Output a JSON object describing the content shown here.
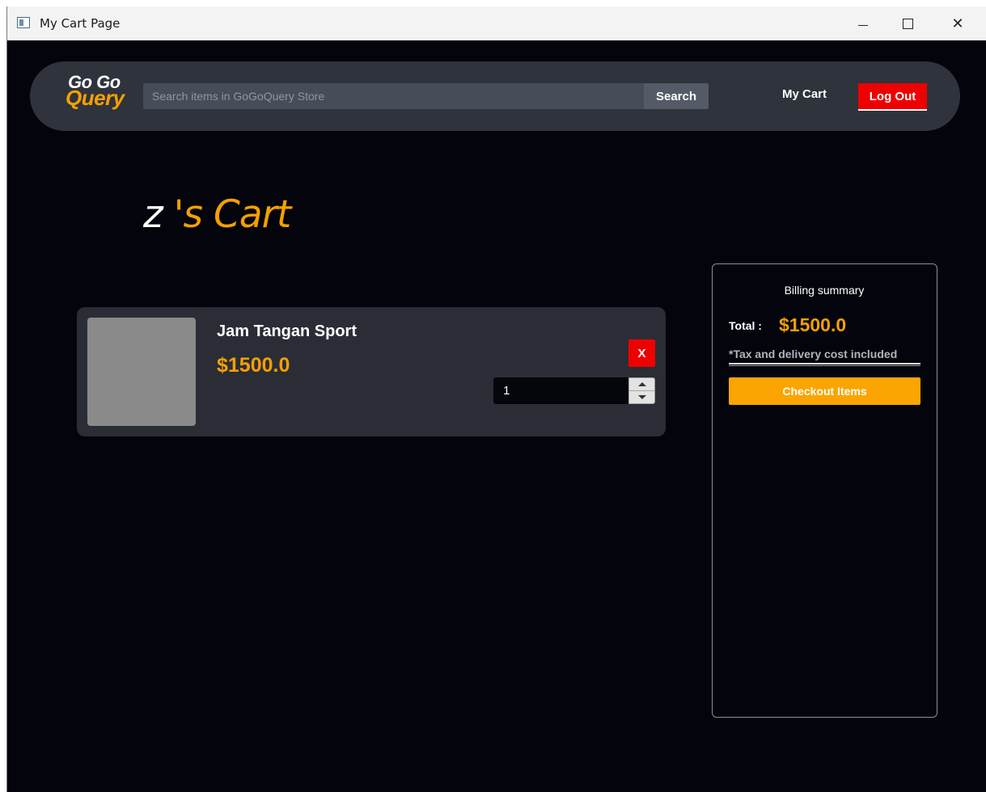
{
  "window": {
    "title": "My Cart Page",
    "minimize_icon": "minimize-icon",
    "maximize_icon": "maximize-icon",
    "close_icon": "close-icon",
    "close_glyph": "✕"
  },
  "navbar": {
    "logo_line1": "Go Go",
    "logo_line2": "Query",
    "search_placeholder": "Search items in GoGoQuery Store",
    "search_value": "",
    "search_label": "Search",
    "my_cart_label": "My Cart",
    "logout_label": "Log Out"
  },
  "cart": {
    "user": "z",
    "title_suffix": " 's Cart",
    "items": [
      {
        "name": "Jam Tangan Sport",
        "price": "$1500.0",
        "quantity": "1",
        "remove_label": "X"
      }
    ]
  },
  "billing": {
    "title": "Billing summary",
    "total_label": "Total :",
    "total_value": "$1500.0",
    "tax_note": "*Tax and delivery cost included",
    "checkout_label": "Checkout Items"
  },
  "colors": {
    "background": "#03040c",
    "navbar": "#2f333c",
    "accent": "#f5a000",
    "danger": "#ee0000",
    "card": "#2a2d36"
  }
}
